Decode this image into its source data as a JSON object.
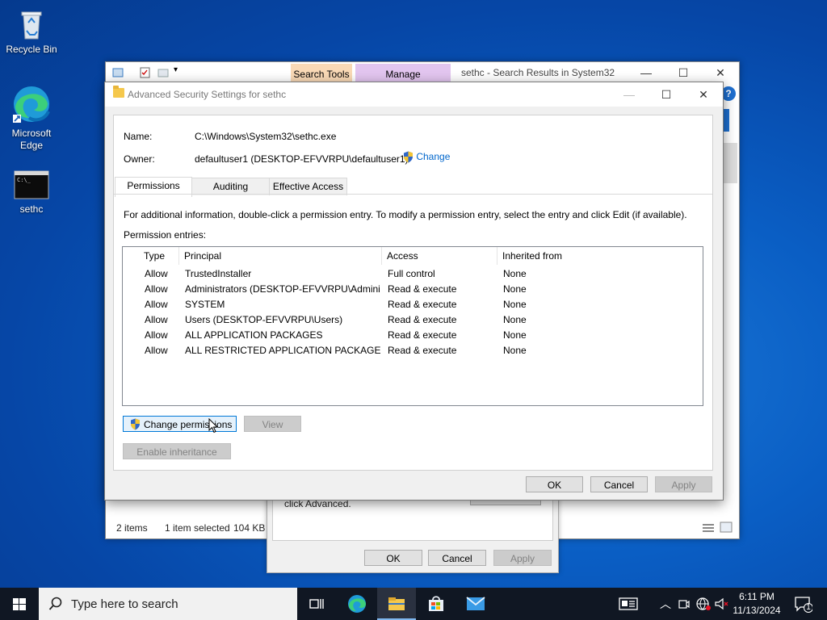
{
  "desktop": {
    "icons": [
      {
        "label": "Recycle Bin"
      },
      {
        "label": "Microsoft Edge"
      },
      {
        "label": "sethc"
      }
    ]
  },
  "explorer": {
    "ribbon_tabs": {
      "search_tools": "Search Tools",
      "manage": "Manage"
    },
    "title": "sethc - Search Results in System32",
    "status": {
      "items": "2 items",
      "selected": "1 item selected",
      "size": "104 KB"
    }
  },
  "properties_dialog": {
    "text": "click Advanced.",
    "ok": "OK",
    "cancel": "Cancel",
    "apply": "Apply"
  },
  "dialog": {
    "title": "Advanced Security Settings for sethc",
    "name_label": "Name:",
    "name_value": "C:\\Windows\\System32\\sethc.exe",
    "owner_label": "Owner:",
    "owner_value": "defaultuser1 (DESKTOP-EFVVRPU\\defaultuser1)",
    "change_link": "Change",
    "tabs": [
      "Permissions",
      "Auditing",
      "Effective Access"
    ],
    "info_text": "For additional information, double-click a permission entry. To modify a permission entry, select the entry and click Edit (if available).",
    "entries_label": "Permission entries:",
    "columns": [
      "Type",
      "Principal",
      "Access",
      "Inherited from"
    ],
    "entries": [
      {
        "type": "Allow",
        "principal": "TrustedInstaller",
        "access": "Full control",
        "inherited": "None",
        "icon": "users-icon"
      },
      {
        "type": "Allow",
        "principal": "Administrators (DESKTOP-EFVVRPU\\Admini...",
        "access": "Read & execute",
        "inherited": "None",
        "icon": "users-icon"
      },
      {
        "type": "Allow",
        "principal": "SYSTEM",
        "access": "Read & execute",
        "inherited": "None",
        "icon": "users-icon"
      },
      {
        "type": "Allow",
        "principal": "Users (DESKTOP-EFVVRPU\\Users)",
        "access": "Read & execute",
        "inherited": "None",
        "icon": "users-icon"
      },
      {
        "type": "Allow",
        "principal": "ALL APPLICATION PACKAGES",
        "access": "Read & execute",
        "inherited": "None",
        "icon": "app-package-icon"
      },
      {
        "type": "Allow",
        "principal": "ALL RESTRICTED APPLICATION PACKAGES",
        "access": "Read & execute",
        "inherited": "None",
        "icon": "app-package-icon"
      }
    ],
    "buttons": {
      "change_permissions": "Change permissions",
      "view": "View",
      "enable_inheritance": "Enable inheritance",
      "ok": "OK",
      "cancel": "Cancel",
      "apply": "Apply"
    }
  },
  "taskbar": {
    "search_placeholder": "Type here to search",
    "time": "6:11 PM",
    "date": "11/13/2024",
    "notification_count": "1"
  }
}
